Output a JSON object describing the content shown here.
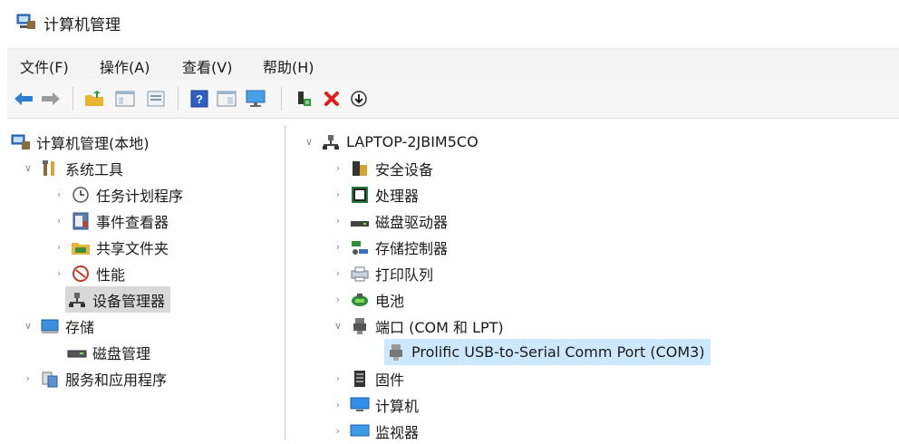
{
  "window": {
    "title": "计算机管理"
  },
  "menu": [
    {
      "label": "文件(F)"
    },
    {
      "label": "操作(A)"
    },
    {
      "label": "查看(V)"
    },
    {
      "label": "帮助(H)"
    }
  ],
  "toolbar": {
    "icons": [
      "back-arrow-icon",
      "forward-arrow-icon",
      "up-folder-icon",
      "show-tree-icon",
      "properties-icon",
      "help-icon",
      "console-tree-icon",
      "monitor-icon",
      "scan-hardware-icon",
      "uninstall-icon",
      "update-driver-icon"
    ]
  },
  "tree": {
    "root": "计算机管理(本地)",
    "system_tools": "系统工具",
    "task_scheduler": "任务计划程序",
    "event_viewer": "事件查看器",
    "shared_folders": "共享文件夹",
    "performance": "性能",
    "device_manager": "设备管理器",
    "storage": "存储",
    "disk_management": "磁盘管理",
    "services_apps": "服务和应用程序"
  },
  "devices": {
    "computer": "LAPTOP-2JBIM5CO",
    "security": "安全设备",
    "processors": "处理器",
    "disk_drives": "磁盘驱动器",
    "storage_controllers": "存储控制器",
    "print_queues": "打印队列",
    "batteries": "电池",
    "ports": "端口 (COM 和 LPT)",
    "prolific": "Prolific USB-to-Serial Comm Port (COM3)",
    "firmware": "固件",
    "computer_cat": "计算机",
    "monitors": "监视器"
  }
}
